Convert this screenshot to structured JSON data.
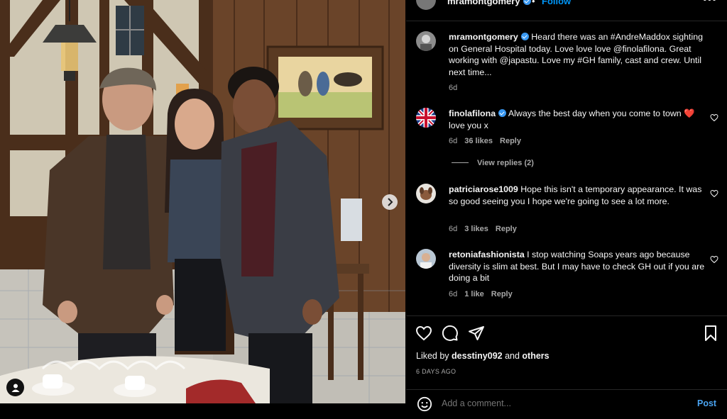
{
  "post_header": {
    "username": "mramontgomery",
    "separator": "•",
    "follow_label": "Follow",
    "more_label": "•••"
  },
  "caption": {
    "username": "mramontgomery",
    "text": "Heard there was an #AndreMaddox sighting on General Hospital today. Love love love @finolafilona. Great working with @japastu. Love my #GH family, cast and crew. Until next time...",
    "age": "6d"
  },
  "comments": [
    {
      "username": "finolafilona",
      "verified": true,
      "text": "Always the best day when you come to town ❤️ love you x",
      "age": "6d",
      "likes": "36 likes",
      "reply_label": "Reply",
      "avatar": "uk-flag-avatar"
    },
    {
      "username": "patriciarose1009",
      "verified": false,
      "text": "Hope this isn't a temporary appearance. It was so good seeing you I hope we're going to see a lot more.",
      "age": "6d",
      "likes": "3 likes",
      "reply_label": "Reply",
      "avatar": "dog-avatar"
    },
    {
      "username": "retoniafashionista",
      "verified": false,
      "text": "I stop watching Soaps years ago because diversity is slim at best. But I may have to check GH out if you are doing a bit",
      "age": "6d",
      "likes": "1 like",
      "reply_label": "Reply",
      "avatar": "person-avatar"
    }
  ],
  "view_replies": "View replies (2)",
  "liked_by": {
    "prefix": "Liked by ",
    "user": "desstiny092",
    "middle": " and ",
    "others": "others"
  },
  "timestamp": "6 DAYS AGO",
  "add_comment": {
    "placeholder": "Add a comment...",
    "post_label": "Post"
  },
  "icons": {
    "like": "heart-icon",
    "comment": "comment-icon",
    "share": "paper-plane-icon",
    "save": "bookmark-icon",
    "emoji": "smiley-icon",
    "next": "chevron-right-icon",
    "tag": "user-tag-icon"
  },
  "colors": {
    "background": "#000000",
    "text": "#f5f5f5",
    "secondary_text": "#a8a8a8",
    "link_blue": "#0095f6",
    "heart_red": "#e0245e"
  }
}
